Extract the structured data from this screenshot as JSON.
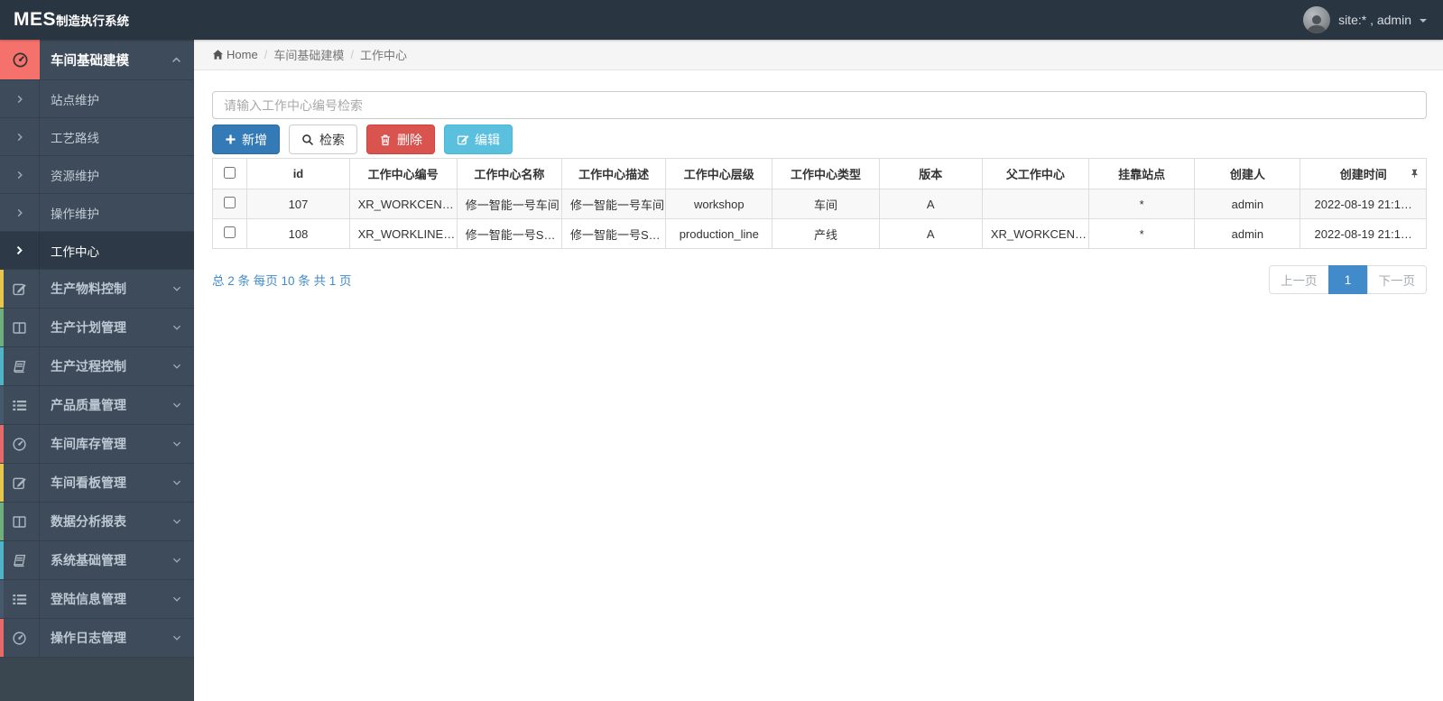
{
  "navbar": {
    "logo_main": "MES",
    "logo_sub": "制造执行系统",
    "user_label": "site:* , admin"
  },
  "breadcrumb": {
    "home": "Home",
    "separator": "/",
    "level1": "车间基础建模",
    "level2": "工作中心"
  },
  "sidebar": {
    "items": [
      {
        "label": "车间基础建模",
        "icon": "tachometer-icon",
        "state": "expanded"
      },
      {
        "label": "站点维护",
        "icon": "chevron-right-icon"
      },
      {
        "label": "工艺路线",
        "icon": "chevron-right-icon"
      },
      {
        "label": "资源维护",
        "icon": "chevron-right-icon"
      },
      {
        "label": "操作维护",
        "icon": "chevron-right-icon"
      },
      {
        "label": "工作中心",
        "icon": "chevron-right-icon",
        "state": "active"
      },
      {
        "label": "生产物料控制",
        "icon": "pencil-square-icon",
        "accent": "yellow"
      },
      {
        "label": "生产计划管理",
        "icon": "columns-icon",
        "accent": "green"
      },
      {
        "label": "生产过程控制",
        "icon": "book-icon",
        "accent": "teal"
      },
      {
        "label": "产品质量管理",
        "icon": "list-icon",
        "accent": "navy"
      },
      {
        "label": "车间库存管理",
        "icon": "tachometer-icon",
        "accent": "red"
      },
      {
        "label": "车间看板管理",
        "icon": "pencil-square-icon",
        "accent": "yellow"
      },
      {
        "label": "数据分析报表",
        "icon": "columns-icon",
        "accent": "green"
      },
      {
        "label": "系统基础管理",
        "icon": "book-icon",
        "accent": "teal"
      },
      {
        "label": "登陆信息管理",
        "icon": "list-icon",
        "accent": "navy"
      },
      {
        "label": "操作日志管理",
        "icon": "tachometer-icon",
        "accent": "red"
      }
    ]
  },
  "toolbar": {
    "search_placeholder": "请输入工作中心编号检索",
    "add_label": "新增",
    "search_label": "检索",
    "delete_label": "删除",
    "edit_label": "编辑"
  },
  "table": {
    "headers": [
      "id",
      "工作中心编号",
      "工作中心名称",
      "工作中心描述",
      "工作中心层级",
      "工作中心类型",
      "版本",
      "父工作中心",
      "挂靠站点",
      "创建人",
      "创建时间"
    ],
    "rows": [
      {
        "cells": [
          "107",
          "XR_WORKCEN…",
          "修一智能一号车间",
          "修一智能一号车间",
          "workshop",
          "车间",
          "A",
          "",
          "*",
          "admin",
          "2022-08-19 21:1…"
        ]
      },
      {
        "cells": [
          "108",
          "XR_WORKLINE…",
          "修一智能一号S…",
          "修一智能一号S…",
          "production_line",
          "产线",
          "A",
          "XR_WORKCEN…",
          "*",
          "admin",
          "2022-08-19 21:1…"
        ]
      }
    ]
  },
  "pagination": {
    "summary": "总 2 条  每页 10 条  共 1 页",
    "prev_label": "上一页",
    "page_label": "1",
    "next_label": "下一页"
  },
  "colors": {
    "primary": "#337ab7",
    "info": "#5bc0de",
    "danger": "#d9534f",
    "link": "#428bca",
    "navbar_bg": "#2a3542",
    "sidebar_bg": "#3d4b5a",
    "sidebar_wrap_bg": "#3a4650",
    "sidebar_active_bg": "#2d3947",
    "accent_red": "#f4716c",
    "strip_yellow": "#e7c64d",
    "strip_green": "#6fae7d",
    "strip_teal": "#4fb4c6",
    "strip_navy": "#46586c",
    "strip_red": "#e66a6a"
  }
}
